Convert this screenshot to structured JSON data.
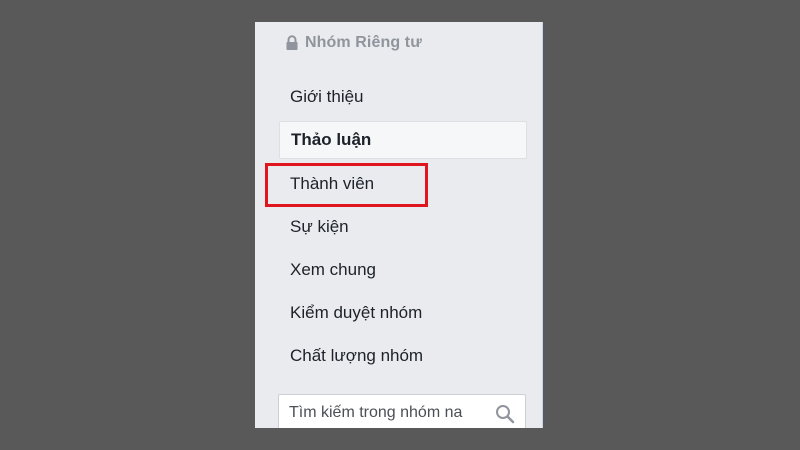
{
  "group": {
    "privacy_label": "Nhóm Riêng tư",
    "privacy_icon": "lock-icon"
  },
  "nav": {
    "items": [
      {
        "label": "Giới thiệu",
        "active": false
      },
      {
        "label": "Thảo luận",
        "active": true
      },
      {
        "label": "Thành viên",
        "active": false,
        "highlighted": true
      },
      {
        "label": "Sự kiện",
        "active": false
      },
      {
        "label": "Xem chung",
        "active": false
      },
      {
        "label": "Kiểm duyệt nhóm",
        "active": false
      },
      {
        "label": "Chất lượng nhóm",
        "active": false
      }
    ]
  },
  "search": {
    "placeholder": "Tìm kiếm trong nhóm na",
    "icon": "search-icon"
  },
  "colors": {
    "background": "#595959",
    "panel": "#e9ebee",
    "highlight": "#e0161e",
    "text": "#1d2129",
    "muted": "#90949c"
  }
}
